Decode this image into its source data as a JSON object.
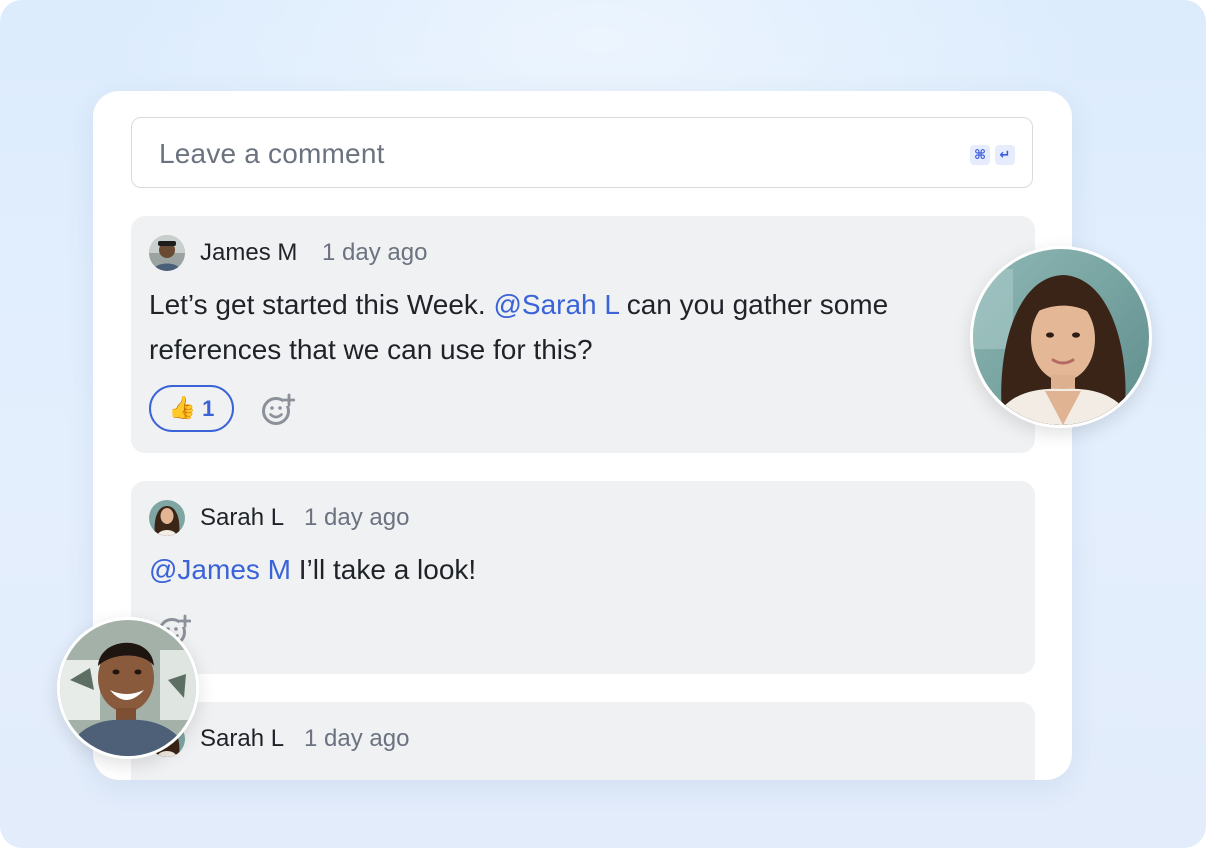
{
  "composer": {
    "placeholder": "Leave a comment",
    "shortcut_keys": [
      "⌘",
      "↵"
    ]
  },
  "comments": [
    {
      "author": "James M",
      "time": "1 day ago",
      "text_before": "Let’s get started this Week. ",
      "mention": "@Sarah L",
      "text_after_line1": " can you gather some",
      "text_line2": "references that we can use for this?",
      "reaction": {
        "emoji": "👍",
        "count": "1"
      }
    },
    {
      "author": "Sarah L",
      "time": "1 day ago",
      "mention": "@James M",
      "text_after": " I’ll take a look!"
    },
    {
      "author": "Sarah L",
      "time": "1 day ago"
    }
  ],
  "colors": {
    "accent": "#3b63d8",
    "bubble": "#f0f1f3",
    "background": "#dde9fb"
  }
}
